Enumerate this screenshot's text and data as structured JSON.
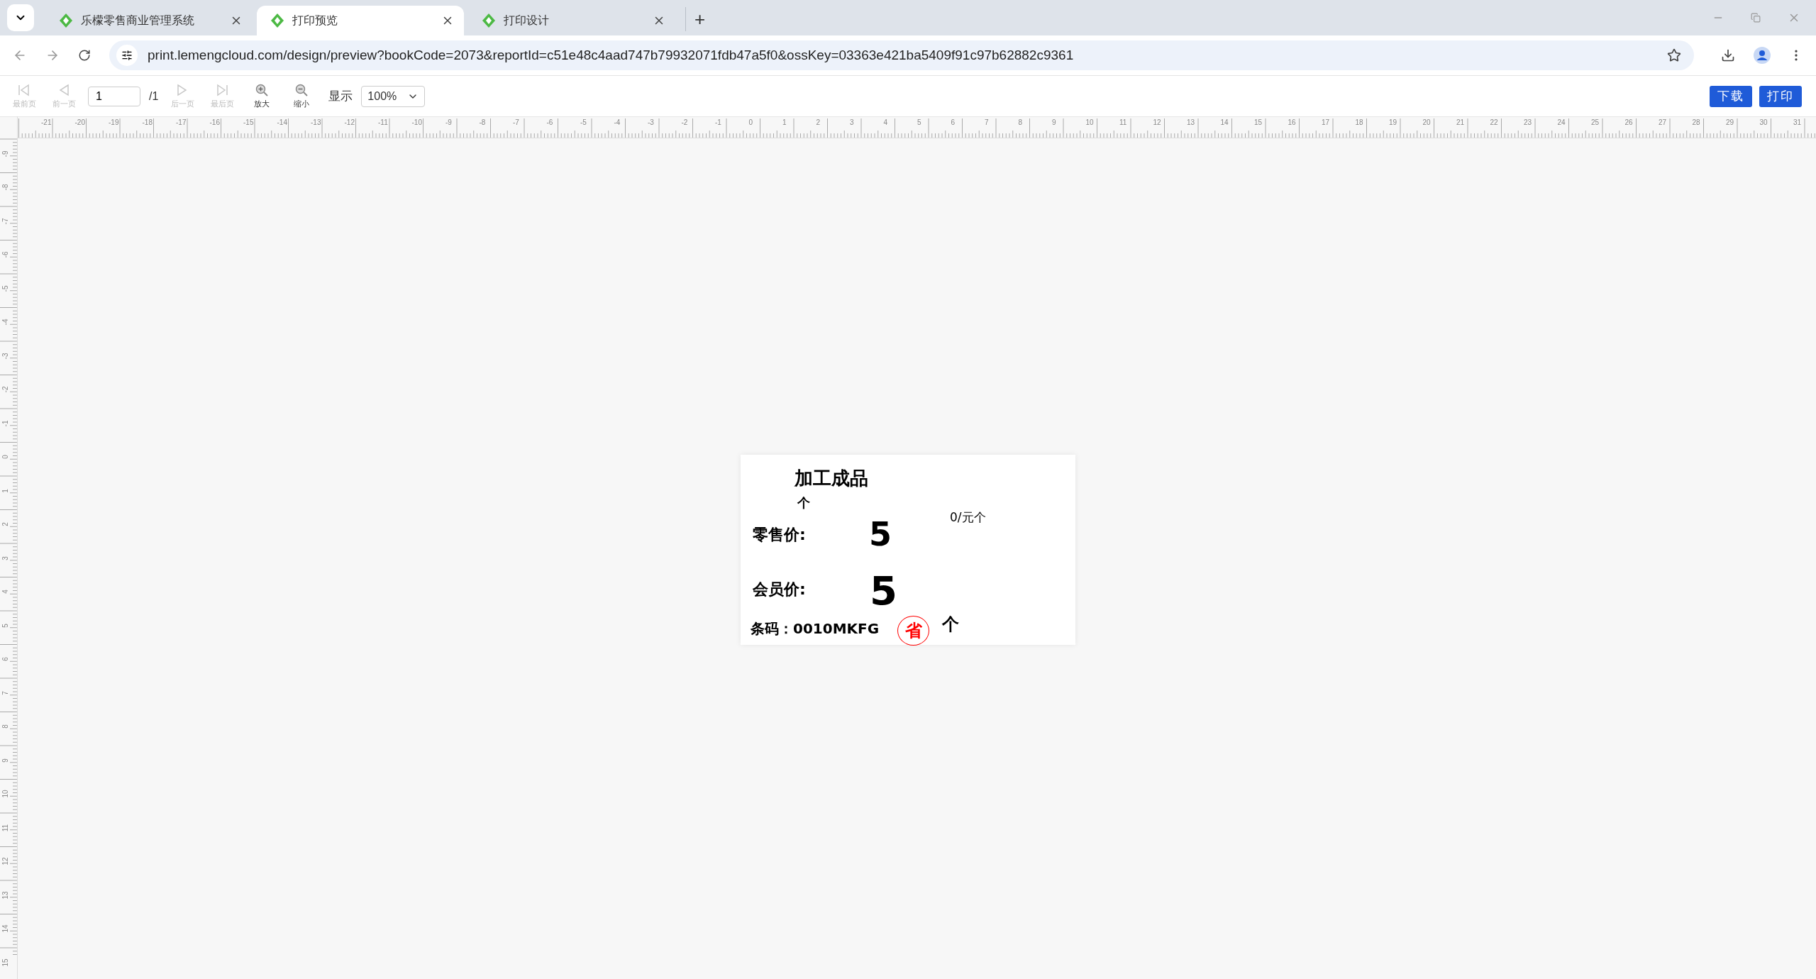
{
  "browser": {
    "tabs": [
      {
        "title": "乐檬零售商业管理系统",
        "selected": false
      },
      {
        "title": "打印预览",
        "selected": true
      },
      {
        "title": "打印设计",
        "selected": false
      }
    ],
    "new_tab": "+",
    "url": "print.lemengcloud.com/design/preview?bookCode=2073&reportId=c51e48c4aad747b79932071fdb47a5f0&ossKey=03363e421ba5409f91c97b62882c9361"
  },
  "toolbar": {
    "buttons": [
      {
        "label": "最前页",
        "kind": "first",
        "disabled": true
      },
      {
        "label": "前一页",
        "kind": "prev",
        "disabled": true
      },
      {
        "label": "后一页",
        "kind": "next",
        "disabled": true
      },
      {
        "label": "最后页",
        "kind": "last",
        "disabled": true
      },
      {
        "label": "放大",
        "kind": "zoom_in",
        "disabled": false
      },
      {
        "label": "缩小",
        "kind": "zoom_out",
        "disabled": false
      }
    ],
    "page_input": "1",
    "page_total": "/1",
    "display_label": "显示",
    "zoom_select": "100%",
    "actions": [
      "下载",
      "打印"
    ]
  },
  "rulers": {
    "horizontal": [
      "-21",
      "-20",
      "-19",
      "-18",
      "-17",
      "-16",
      "-15",
      "-14",
      "-13",
      "-12",
      "-11",
      "-10",
      "-9",
      "-8",
      "-7",
      "-6",
      "-5",
      "-4",
      "-3",
      "-2",
      "-1",
      "0",
      "1",
      "2",
      "3",
      "4",
      "5",
      "6",
      "7",
      "8",
      "9",
      "10",
      "11",
      "12",
      "13",
      "14",
      "15",
      "16",
      "17",
      "18",
      "19",
      "20",
      "21",
      "22",
      "23",
      "24",
      "25",
      "26",
      "27",
      "28",
      "29",
      "30",
      "31"
    ],
    "vertical": [
      "-9",
      "-8",
      "-7",
      "-6",
      "-5",
      "-4",
      "-3",
      "-2",
      "-1",
      "0",
      "1",
      "2",
      "3",
      "4",
      "5",
      "6",
      "7",
      "8",
      "9",
      "10",
      "11",
      "12",
      "13",
      "14",
      "15"
    ]
  },
  "label": {
    "title": "加工成品",
    "unit": "个",
    "unit_price": "0/元个",
    "retail_label": "零售价:",
    "retail_price": "5",
    "member_label": "会员价:",
    "member_price": "5",
    "barcode": "条码：0010MKFG",
    "stamp": "省",
    "stamp_unit": "个"
  }
}
